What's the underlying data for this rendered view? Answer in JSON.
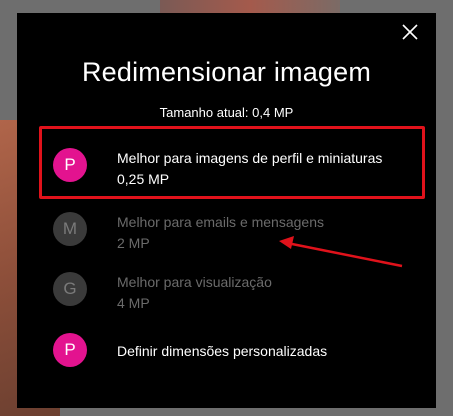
{
  "dialog": {
    "title": "Redimensionar imagem",
    "current_size": "Tamanho atual: 0,4 MP",
    "close_icon": "close-icon"
  },
  "options": [
    {
      "avatar": "P",
      "title": "Melhor para imagens de perfil e miniaturas",
      "subtitle": "0,25 MP",
      "enabled": true,
      "highlighted": true,
      "avatar_color": "#e3138f"
    },
    {
      "avatar": "M",
      "title": "Melhor para emails e mensagens",
      "subtitle": "2 MP",
      "enabled": false,
      "avatar_color": "#3a3a3a"
    },
    {
      "avatar": "G",
      "title": "Melhor para visualização",
      "subtitle": "4 MP",
      "enabled": false,
      "avatar_color": "#3a3a3a"
    },
    {
      "avatar": "P",
      "title": "Definir dimensões personalizadas",
      "subtitle": "",
      "enabled": true,
      "avatar_color": "#e3138f"
    }
  ],
  "annotation": {
    "highlight_color": "#e0121b",
    "arrow_color": "#e0121b"
  }
}
